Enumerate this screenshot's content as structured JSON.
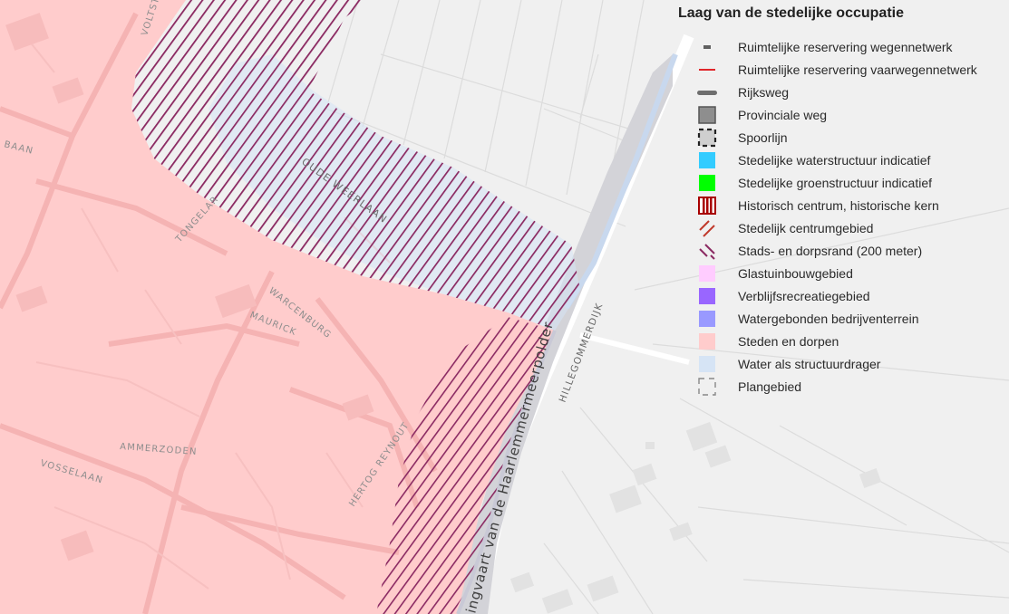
{
  "legend": {
    "title": "Laag van de stedelijke occupatie",
    "items": [
      {
        "label": "Ruimtelijke reservering wegennetwerk",
        "symbol": "dash-gray",
        "color": "#606060"
      },
      {
        "label": "Ruimtelijke reservering vaarwegennetwerk",
        "symbol": "line-red",
        "color": "#e0262a"
      },
      {
        "label": "Rijksweg",
        "symbol": "thick-line-gray",
        "color": "#6e6e6e"
      },
      {
        "label": "Provinciale weg",
        "symbol": "square-gray",
        "color": "#8e8e8e"
      },
      {
        "label": "Spoorlijn",
        "symbol": "dashed-square",
        "color": "#222222"
      },
      {
        "label": "Stedelijke waterstructuur indicatief",
        "symbol": "square-fill",
        "color": "#33ccff"
      },
      {
        "label": "Stedelijke groenstructuur indicatief",
        "symbol": "square-fill",
        "color": "#00ff00"
      },
      {
        "label": "Historisch centrum, historische kern",
        "symbol": "vertical-stripes",
        "color": "#a80000"
      },
      {
        "label": "Stedelijk centrumgebied",
        "symbol": "diagonal-red",
        "color": "#c0392b"
      },
      {
        "label": "Stads- en dorpsrand (200 meter)",
        "symbol": "diagonal-purple",
        "color": "#8b2a62"
      },
      {
        "label": "Glastuinbouwgebied",
        "symbol": "square-fill",
        "color": "#ffccff"
      },
      {
        "label": "Verblijfsrecreatiegebied",
        "symbol": "square-fill",
        "color": "#9966ff"
      },
      {
        "label": "Watergebonden bedrijventerrein",
        "symbol": "square-fill",
        "color": "#9999ff"
      },
      {
        "label": "Steden en dorpen",
        "symbol": "square-fill",
        "color": "#ffcccc"
      },
      {
        "label": "Water als structuurdrager",
        "symbol": "square-fill",
        "color": "#d6e4f5"
      },
      {
        "label": "Plangebied",
        "symbol": "dashed-outline",
        "color": "#888888"
      }
    ]
  },
  "map": {
    "street_labels": {
      "voltstraat": "VOLTST",
      "baan": "BAAN",
      "oude_weerlaan": "OUDE WEERLAAN",
      "tongelaar": "TONGELAR",
      "warcenburg": "WARCENBURG",
      "maurick": "MAURICK",
      "ammerzoden": "AMMERZODEN",
      "vosselaan": "VOSSELAAN",
      "hertog_reynout": "HERTOG REYNOUT",
      "ringvaart": "ingvaart van de Haarlemmermeerpolder",
      "hillegommerdijk": "HILLEGOMMERDIJK"
    },
    "colors": {
      "background": "#f0f0f0",
      "urban_fill": "#ffcccc",
      "hatch": "#8b2a62",
      "water": "#d6e4f5",
      "canal": "#d3d3d8"
    }
  }
}
